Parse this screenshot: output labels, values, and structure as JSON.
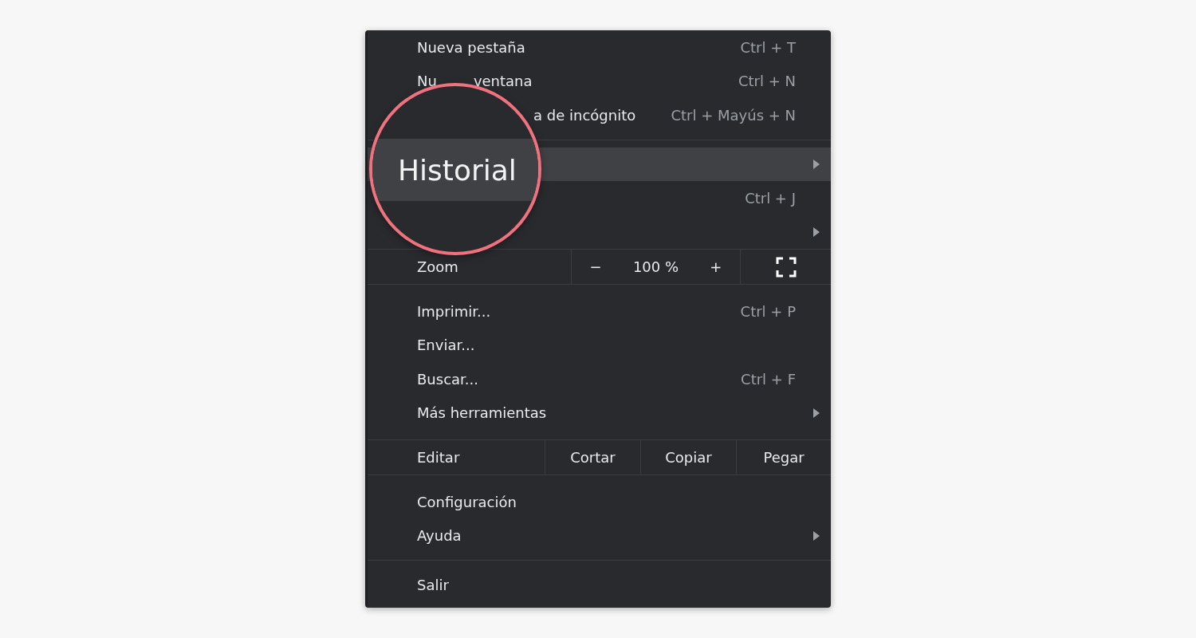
{
  "menu": {
    "rows": [
      {
        "kind": "item",
        "label": "Nueva pestaña",
        "shortcut": "Ctrl + T",
        "submenu": false,
        "highlighted": false
      },
      {
        "kind": "item",
        "label": "Nu",
        "label_tail": "ventana",
        "shortcut": "Ctrl + N",
        "submenu": false,
        "highlighted": false
      },
      {
        "kind": "item",
        "label": "a de incógnito",
        "label_covered": true,
        "shortcut": "Ctrl + Mayús + N",
        "submenu": false,
        "highlighted": false
      },
      {
        "kind": "separator"
      },
      {
        "kind": "item",
        "submenu": true,
        "highlighted": true
      },
      {
        "kind": "item",
        "shortcut": "Ctrl + J",
        "submenu": false,
        "highlighted": false
      },
      {
        "kind": "item",
        "submenu": true,
        "highlighted": false
      },
      {
        "kind": "zoom",
        "label": "Zoom",
        "minus": "−",
        "value": "100 %",
        "plus": "+"
      },
      {
        "kind": "item",
        "label": "Imprimir...",
        "shortcut": "Ctrl + P",
        "submenu": false,
        "highlighted": false
      },
      {
        "kind": "item",
        "label": "Enviar...",
        "submenu": false,
        "highlighted": false
      },
      {
        "kind": "item",
        "label": "Buscar...",
        "shortcut": "Ctrl + F",
        "submenu": false,
        "highlighted": false
      },
      {
        "kind": "item",
        "label": "Más herramientas",
        "submenu": true,
        "highlighted": false
      },
      {
        "kind": "edit",
        "label": "Editar",
        "actions": [
          "Cortar",
          "Copiar",
          "Pegar"
        ]
      },
      {
        "kind": "item",
        "label": "Configuración",
        "submenu": false,
        "highlighted": false
      },
      {
        "kind": "item",
        "label": "Ayuda",
        "submenu": true,
        "highlighted": false
      },
      {
        "kind": "separator"
      },
      {
        "kind": "item",
        "label": "Salir",
        "submenu": false,
        "highlighted": false
      }
    ]
  },
  "magnifier": {
    "label": "Historial"
  }
}
